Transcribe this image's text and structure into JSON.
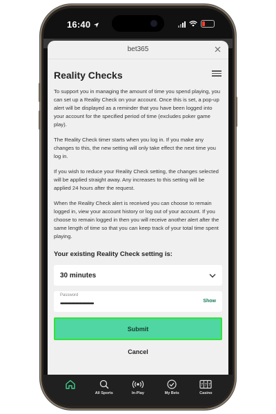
{
  "status_bar": {
    "time": "16:40"
  },
  "modal": {
    "header_title": "bet365",
    "page_title": "Reality Checks",
    "paragraphs": [
      "To support you in managing the amount of time you spend playing, you can set up a Reality Check on your account. Once this is set, a pop-up alert will be displayed as a reminder that you have been logged into your account for the specified period of time (excludes poker game play).",
      "The Reality Check timer starts when you log in. If you make any changes to this, the new setting will only take effect the next time you log in.",
      "If you wish to reduce your Reality Check setting, the changes selected will be applied straight away. Any increases to this setting will be applied 24 hours after the request.",
      "When the Reality Check alert is received you can choose to remain logged in, view your account history or log out of your account. If you choose to remain logged in then you will receive another alert after the same length of time so that you can keep track of your total time spent playing."
    ],
    "setting_label": "Your existing Reality Check setting is:",
    "setting_value": "30 minutes",
    "password": {
      "label": "Password",
      "masked_value": "••••••••••••••••••••••••",
      "show_label": "Show"
    },
    "submit_label": "Submit",
    "cancel_label": "Cancel"
  },
  "tab_bar": {
    "items": [
      {
        "label": "",
        "icon": "home-icon",
        "active": true
      },
      {
        "label": "All Sports",
        "icon": "search-icon"
      },
      {
        "label": "In-Play",
        "icon": "in-play-icon"
      },
      {
        "label": "My Bets",
        "icon": "my-bets-icon"
      },
      {
        "label": "Casino",
        "icon": "casino-icon"
      }
    ]
  },
  "colors": {
    "accent": "#4fd6a2",
    "highlight_border": "#34e334",
    "show_link": "#127a57",
    "active_tab": "#3fcf8e"
  }
}
